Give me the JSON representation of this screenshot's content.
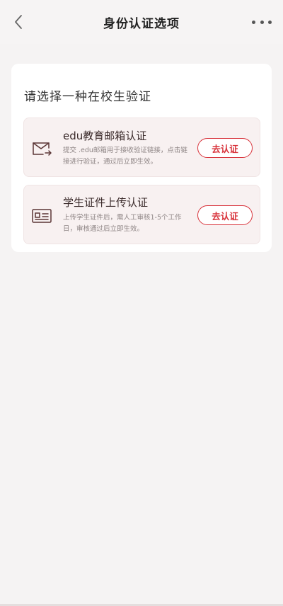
{
  "navbar": {
    "title": "身份认证选项",
    "back_icon": "chevron-left-icon",
    "more_icon": "more-dots-icon"
  },
  "card": {
    "title": "请选择一种在校生验证",
    "options": [
      {
        "name": "edu教育邮箱认证",
        "description": "提交 .edu邮箱用于接收验证链接，点击链接进行验证，通过后立即生效。",
        "button": "去认证",
        "icon": "email-forward-icon"
      },
      {
        "name": "学生证件上传认证",
        "description": "上传学生证件后，需人工审核1-5个工作日，审核通过后立即生效。",
        "button": "去认证",
        "icon": "id-card-icon"
      }
    ]
  },
  "colors": {
    "accent": "#d8333b",
    "background": "#f5f3f3",
    "option_bg": "#f8f1f1"
  }
}
